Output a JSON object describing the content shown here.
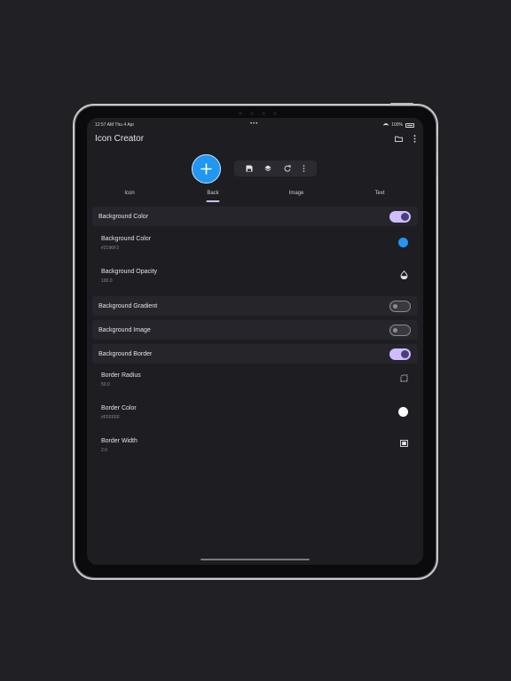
{
  "status_bar": {
    "time": "12:57 AM  Thu 4 Apr",
    "dots": "•••",
    "battery": "100%"
  },
  "app": {
    "title": "Icon Creator"
  },
  "toolbar": {
    "icons": [
      "save-icon",
      "layers-icon",
      "refresh-icon",
      "more-vert-icon"
    ]
  },
  "tabs": [
    {
      "label": "Icon",
      "active": false
    },
    {
      "label": "Back",
      "active": true
    },
    {
      "label": "Image",
      "active": false
    },
    {
      "label": "Text",
      "active": false
    }
  ],
  "sections": {
    "background_color": {
      "title": "Background Color",
      "enabled": true,
      "color": {
        "label": "Background Color",
        "value": "#2196F3",
        "swatch": "#2196f3"
      },
      "opacity": {
        "label": "Background Opacity",
        "value": "100.0"
      }
    },
    "background_gradient": {
      "title": "Background Gradient",
      "enabled": false
    },
    "background_image": {
      "title": "Background Image",
      "enabled": false
    },
    "background_border": {
      "title": "Background Border",
      "enabled": true,
      "radius": {
        "label": "Border Radius",
        "value": "50.0"
      },
      "color": {
        "label": "Border Color",
        "value": "#FFFFFF",
        "swatch": "#ffffff"
      },
      "width": {
        "label": "Border Width",
        "value": "2.0"
      }
    }
  },
  "colors": {
    "accent": "#cfbdfe",
    "fab": "#2196f3",
    "surface": "#1e1d22"
  }
}
